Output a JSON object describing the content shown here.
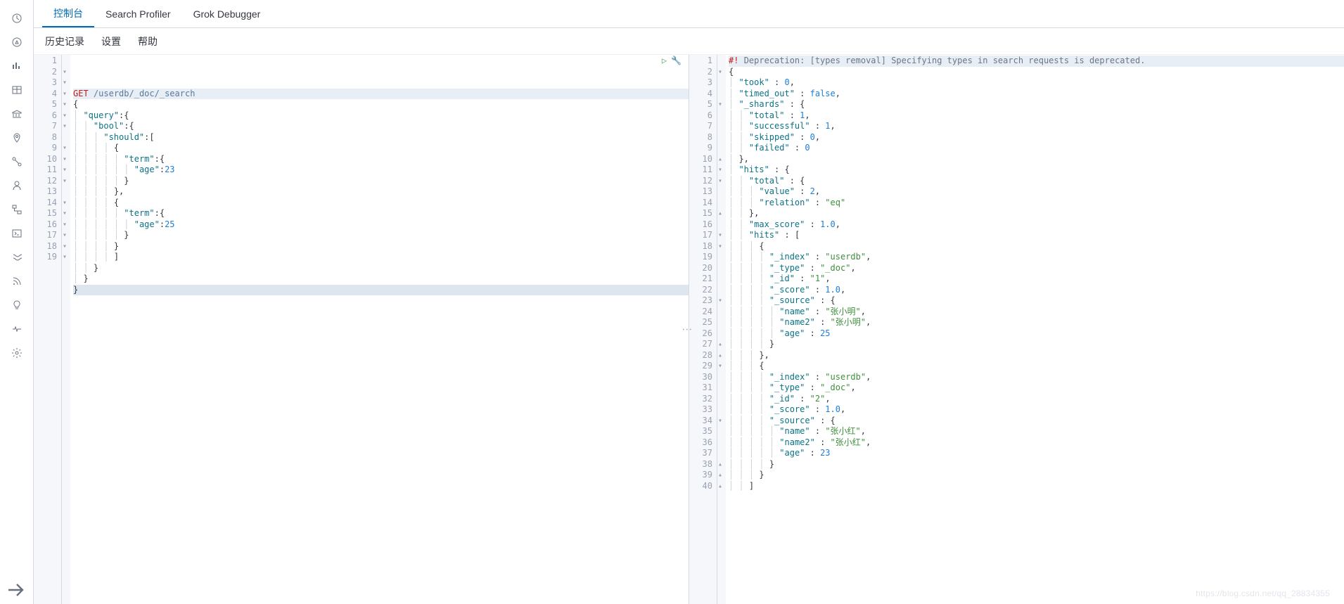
{
  "tabs": [
    "控制台",
    "Search Profiler",
    "Grok Debugger"
  ],
  "activeTab": 0,
  "subtabs": [
    "历史记录",
    "设置",
    "帮助"
  ],
  "sidebarIcons": [
    "clock-icon",
    "compass-icon",
    "chart-bar-icon",
    "table-icon",
    "bank-icon",
    "pin-icon",
    "graph-icon",
    "user-icon",
    "flow-icon",
    "console-icon",
    "stream-icon",
    "rss-icon",
    "bulb-icon",
    "heartbeat-icon",
    "gear-icon"
  ],
  "collapseIcon": "collapse-icon",
  "request": {
    "method": "GET",
    "path": "/userdb/_doc/_search",
    "lines": [
      {
        "n": 1,
        "fold": "",
        "content": [
          [
            "method",
            "GET"
          ],
          [
            "space",
            " "
          ],
          [
            "path",
            "/userdb/_doc/_search"
          ]
        ],
        "cls": "hl-line1"
      },
      {
        "n": 2,
        "fold": "▾",
        "content": [
          [
            "punct",
            "{"
          ]
        ]
      },
      {
        "n": 3,
        "fold": "▾",
        "content": [
          [
            "indent",
            "  "
          ],
          [
            "key",
            "\"query\""
          ],
          [
            "punct",
            ":{"
          ]
        ]
      },
      {
        "n": 4,
        "fold": "▾",
        "content": [
          [
            "indent",
            "    "
          ],
          [
            "key",
            "\"bool\""
          ],
          [
            "punct",
            ":{"
          ]
        ]
      },
      {
        "n": 5,
        "fold": "▾",
        "content": [
          [
            "indent",
            "      "
          ],
          [
            "key",
            "\"should\""
          ],
          [
            "punct",
            ":["
          ]
        ]
      },
      {
        "n": 6,
        "fold": "▾",
        "content": [
          [
            "indent",
            "        "
          ],
          [
            "punct",
            "{"
          ]
        ]
      },
      {
        "n": 7,
        "fold": "▾",
        "content": [
          [
            "indent",
            "          "
          ],
          [
            "key",
            "\"term\""
          ],
          [
            "punct",
            ":{"
          ]
        ]
      },
      {
        "n": 8,
        "fold": "",
        "content": [
          [
            "indent",
            "            "
          ],
          [
            "key",
            "\"age\""
          ],
          [
            "punct",
            ":"
          ],
          [
            "num",
            "23"
          ]
        ]
      },
      {
        "n": 9,
        "fold": "▾",
        "content": [
          [
            "indent",
            "          "
          ],
          [
            "punct",
            "}"
          ]
        ]
      },
      {
        "n": 10,
        "fold": "▾",
        "content": [
          [
            "indent",
            "        "
          ],
          [
            "punct",
            "},"
          ]
        ]
      },
      {
        "n": 11,
        "fold": "▾",
        "content": [
          [
            "indent",
            "        "
          ],
          [
            "punct",
            "{"
          ]
        ]
      },
      {
        "n": 12,
        "fold": "▾",
        "content": [
          [
            "indent",
            "          "
          ],
          [
            "key",
            "\"term\""
          ],
          [
            "punct",
            ":{"
          ]
        ]
      },
      {
        "n": 13,
        "fold": "",
        "content": [
          [
            "indent",
            "            "
          ],
          [
            "key",
            "\"age\""
          ],
          [
            "punct",
            ":"
          ],
          [
            "num",
            "25"
          ]
        ]
      },
      {
        "n": 14,
        "fold": "▾",
        "content": [
          [
            "indent",
            "          "
          ],
          [
            "punct",
            "}"
          ]
        ]
      },
      {
        "n": 15,
        "fold": "▾",
        "content": [
          [
            "indent",
            "        "
          ],
          [
            "punct",
            "}"
          ]
        ]
      },
      {
        "n": 16,
        "fold": "▾",
        "content": [
          [
            "indent",
            "        "
          ],
          [
            "punct",
            "]"
          ]
        ]
      },
      {
        "n": 17,
        "fold": "▾",
        "content": [
          [
            "indent",
            "    "
          ],
          [
            "punct",
            "}"
          ]
        ]
      },
      {
        "n": 18,
        "fold": "▾",
        "content": [
          [
            "indent",
            "  "
          ],
          [
            "punct",
            "}"
          ]
        ]
      },
      {
        "n": 19,
        "fold": "▾",
        "content": [
          [
            "punct",
            "}"
          ]
        ],
        "cls": "hl-last"
      }
    ]
  },
  "response": {
    "lines": [
      {
        "n": 1,
        "fold": "",
        "content": [
          [
            "warn",
            "#!"
          ],
          [
            "space",
            " "
          ],
          [
            "warn-text",
            "Deprecation: [types removal] Specifying types in search requests is deprecated."
          ]
        ],
        "cls": "resp-line1"
      },
      {
        "n": 2,
        "fold": "▾",
        "content": [
          [
            "punct",
            "{"
          ]
        ]
      },
      {
        "n": 3,
        "fold": "",
        "content": [
          [
            "indent",
            "  "
          ],
          [
            "key",
            "\"took\""
          ],
          [
            "punct",
            " : "
          ],
          [
            "num",
            "0"
          ],
          [
            "punct",
            ","
          ]
        ]
      },
      {
        "n": 4,
        "fold": "",
        "content": [
          [
            "indent",
            "  "
          ],
          [
            "key",
            "\"timed_out\""
          ],
          [
            "punct",
            " : "
          ],
          [
            "bool",
            "false"
          ],
          [
            "punct",
            ","
          ]
        ]
      },
      {
        "n": 5,
        "fold": "▾",
        "content": [
          [
            "indent",
            "  "
          ],
          [
            "key",
            "\"_shards\""
          ],
          [
            "punct",
            " : {"
          ]
        ]
      },
      {
        "n": 6,
        "fold": "",
        "content": [
          [
            "indent",
            "    "
          ],
          [
            "key",
            "\"total\""
          ],
          [
            "punct",
            " : "
          ],
          [
            "num",
            "1"
          ],
          [
            "punct",
            ","
          ]
        ]
      },
      {
        "n": 7,
        "fold": "",
        "content": [
          [
            "indent",
            "    "
          ],
          [
            "key",
            "\"successful\""
          ],
          [
            "punct",
            " : "
          ],
          [
            "num",
            "1"
          ],
          [
            "punct",
            ","
          ]
        ]
      },
      {
        "n": 8,
        "fold": "",
        "content": [
          [
            "indent",
            "    "
          ],
          [
            "key",
            "\"skipped\""
          ],
          [
            "punct",
            " : "
          ],
          [
            "num",
            "0"
          ],
          [
            "punct",
            ","
          ]
        ]
      },
      {
        "n": 9,
        "fold": "",
        "content": [
          [
            "indent",
            "    "
          ],
          [
            "key",
            "\"failed\""
          ],
          [
            "punct",
            " : "
          ],
          [
            "num",
            "0"
          ]
        ]
      },
      {
        "n": 10,
        "fold": "▴",
        "content": [
          [
            "indent",
            "  "
          ],
          [
            "punct",
            "},"
          ]
        ]
      },
      {
        "n": 11,
        "fold": "▾",
        "content": [
          [
            "indent",
            "  "
          ],
          [
            "key",
            "\"hits\""
          ],
          [
            "punct",
            " : {"
          ]
        ]
      },
      {
        "n": 12,
        "fold": "▾",
        "content": [
          [
            "indent",
            "    "
          ],
          [
            "key",
            "\"total\""
          ],
          [
            "punct",
            " : {"
          ]
        ]
      },
      {
        "n": 13,
        "fold": "",
        "content": [
          [
            "indent",
            "      "
          ],
          [
            "key",
            "\"value\""
          ],
          [
            "punct",
            " : "
          ],
          [
            "num",
            "2"
          ],
          [
            "punct",
            ","
          ]
        ]
      },
      {
        "n": 14,
        "fold": "",
        "content": [
          [
            "indent",
            "      "
          ],
          [
            "key",
            "\"relation\""
          ],
          [
            "punct",
            " : "
          ],
          [
            "str",
            "\"eq\""
          ]
        ]
      },
      {
        "n": 15,
        "fold": "▴",
        "content": [
          [
            "indent",
            "    "
          ],
          [
            "punct",
            "},"
          ]
        ]
      },
      {
        "n": 16,
        "fold": "",
        "content": [
          [
            "indent",
            "    "
          ],
          [
            "key",
            "\"max_score\""
          ],
          [
            "punct",
            " : "
          ],
          [
            "num",
            "1.0"
          ],
          [
            "punct",
            ","
          ]
        ]
      },
      {
        "n": 17,
        "fold": "▾",
        "content": [
          [
            "indent",
            "    "
          ],
          [
            "key",
            "\"hits\""
          ],
          [
            "punct",
            " : ["
          ]
        ]
      },
      {
        "n": 18,
        "fold": "▾",
        "content": [
          [
            "indent",
            "      "
          ],
          [
            "punct",
            "{"
          ]
        ]
      },
      {
        "n": 19,
        "fold": "",
        "content": [
          [
            "indent",
            "        "
          ],
          [
            "key",
            "\"_index\""
          ],
          [
            "punct",
            " : "
          ],
          [
            "str",
            "\"userdb\""
          ],
          [
            "punct",
            ","
          ]
        ]
      },
      {
        "n": 20,
        "fold": "",
        "content": [
          [
            "indent",
            "        "
          ],
          [
            "key",
            "\"_type\""
          ],
          [
            "punct",
            " : "
          ],
          [
            "str",
            "\"_doc\""
          ],
          [
            "punct",
            ","
          ]
        ]
      },
      {
        "n": 21,
        "fold": "",
        "content": [
          [
            "indent",
            "        "
          ],
          [
            "key",
            "\"_id\""
          ],
          [
            "punct",
            " : "
          ],
          [
            "str",
            "\"1\""
          ],
          [
            "punct",
            ","
          ]
        ]
      },
      {
        "n": 22,
        "fold": "",
        "content": [
          [
            "indent",
            "        "
          ],
          [
            "key",
            "\"_score\""
          ],
          [
            "punct",
            " : "
          ],
          [
            "num",
            "1.0"
          ],
          [
            "punct",
            ","
          ]
        ]
      },
      {
        "n": 23,
        "fold": "▾",
        "content": [
          [
            "indent",
            "        "
          ],
          [
            "key",
            "\"_source\""
          ],
          [
            "punct",
            " : {"
          ]
        ]
      },
      {
        "n": 24,
        "fold": "",
        "content": [
          [
            "indent",
            "          "
          ],
          [
            "key",
            "\"name\""
          ],
          [
            "punct",
            " : "
          ],
          [
            "str",
            "\"张小明\""
          ],
          [
            "punct",
            ","
          ]
        ]
      },
      {
        "n": 25,
        "fold": "",
        "content": [
          [
            "indent",
            "          "
          ],
          [
            "key",
            "\"name2\""
          ],
          [
            "punct",
            " : "
          ],
          [
            "str",
            "\"张小明\""
          ],
          [
            "punct",
            ","
          ]
        ]
      },
      {
        "n": 26,
        "fold": "",
        "content": [
          [
            "indent",
            "          "
          ],
          [
            "key",
            "\"age\""
          ],
          [
            "punct",
            " : "
          ],
          [
            "num",
            "25"
          ]
        ]
      },
      {
        "n": 27,
        "fold": "▴",
        "content": [
          [
            "indent",
            "        "
          ],
          [
            "punct",
            "}"
          ]
        ]
      },
      {
        "n": 28,
        "fold": "▴",
        "content": [
          [
            "indent",
            "      "
          ],
          [
            "punct",
            "},"
          ]
        ]
      },
      {
        "n": 29,
        "fold": "▾",
        "content": [
          [
            "indent",
            "      "
          ],
          [
            "punct",
            "{"
          ]
        ]
      },
      {
        "n": 30,
        "fold": "",
        "content": [
          [
            "indent",
            "        "
          ],
          [
            "key",
            "\"_index\""
          ],
          [
            "punct",
            " : "
          ],
          [
            "str",
            "\"userdb\""
          ],
          [
            "punct",
            ","
          ]
        ]
      },
      {
        "n": 31,
        "fold": "",
        "content": [
          [
            "indent",
            "        "
          ],
          [
            "key",
            "\"_type\""
          ],
          [
            "punct",
            " : "
          ],
          [
            "str",
            "\"_doc\""
          ],
          [
            "punct",
            ","
          ]
        ]
      },
      {
        "n": 32,
        "fold": "",
        "content": [
          [
            "indent",
            "        "
          ],
          [
            "key",
            "\"_id\""
          ],
          [
            "punct",
            " : "
          ],
          [
            "str",
            "\"2\""
          ],
          [
            "punct",
            ","
          ]
        ]
      },
      {
        "n": 33,
        "fold": "",
        "content": [
          [
            "indent",
            "        "
          ],
          [
            "key",
            "\"_score\""
          ],
          [
            "punct",
            " : "
          ],
          [
            "num",
            "1.0"
          ],
          [
            "punct",
            ","
          ]
        ]
      },
      {
        "n": 34,
        "fold": "▾",
        "content": [
          [
            "indent",
            "        "
          ],
          [
            "key",
            "\"_source\""
          ],
          [
            "punct",
            " : {"
          ]
        ]
      },
      {
        "n": 35,
        "fold": "",
        "content": [
          [
            "indent",
            "          "
          ],
          [
            "key",
            "\"name\""
          ],
          [
            "punct",
            " : "
          ],
          [
            "str",
            "\"张小红\""
          ],
          [
            "punct",
            ","
          ]
        ]
      },
      {
        "n": 36,
        "fold": "",
        "content": [
          [
            "indent",
            "          "
          ],
          [
            "key",
            "\"name2\""
          ],
          [
            "punct",
            " : "
          ],
          [
            "str",
            "\"张小红\""
          ],
          [
            "punct",
            ","
          ]
        ]
      },
      {
        "n": 37,
        "fold": "",
        "content": [
          [
            "indent",
            "          "
          ],
          [
            "key",
            "\"age\""
          ],
          [
            "punct",
            " : "
          ],
          [
            "num",
            "23"
          ]
        ]
      },
      {
        "n": 38,
        "fold": "▴",
        "content": [
          [
            "indent",
            "        "
          ],
          [
            "punct",
            "}"
          ]
        ]
      },
      {
        "n": 39,
        "fold": "▴",
        "content": [
          [
            "indent",
            "      "
          ],
          [
            "punct",
            "}"
          ]
        ]
      },
      {
        "n": 40,
        "fold": "▴",
        "content": [
          [
            "indent",
            "    "
          ],
          [
            "punct",
            "]"
          ]
        ]
      }
    ]
  },
  "actions": {
    "run": "▷",
    "wrench": "🔧"
  },
  "watermark": "https://blog.csdn.net/qq_28834355"
}
